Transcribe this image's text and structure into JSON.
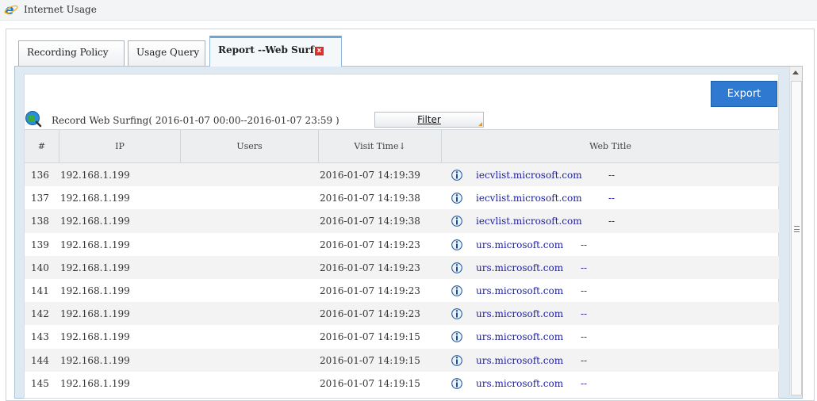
{
  "window": {
    "title": "Internet Usage"
  },
  "tabs": [
    {
      "label": "Recording Policy"
    },
    {
      "label": "Usage Query"
    },
    {
      "label": "Report --Web Surf",
      "close": "x"
    }
  ],
  "toolbar": {
    "export_label": "Export",
    "filter_label": "Filter"
  },
  "record": {
    "title": "Record Web Surfing( 2016-01-07 00:00--2016-01-07 23:59 )"
  },
  "table": {
    "headers": [
      "#",
      "IP",
      "Users",
      "Visit Time↓",
      "Web Title"
    ],
    "rows": [
      {
        "num": "136",
        "ip": "192.168.1.199",
        "user": "",
        "time": "2016-01-07 14:19:39",
        "title": "iecvlist.microsoft.com",
        "suffix": "--"
      },
      {
        "num": "137",
        "ip": "192.168.1.199",
        "user": "",
        "time": "2016-01-07 14:19:38",
        "title": "iecvlist.microsoft.com",
        "suffix": "--"
      },
      {
        "num": "138",
        "ip": "192.168.1.199",
        "user": "",
        "time": "2016-01-07 14:19:38",
        "title": "iecvlist.microsoft.com",
        "suffix": "--"
      },
      {
        "num": "139",
        "ip": "192.168.1.199",
        "user": "",
        "time": "2016-01-07 14:19:23",
        "title": "urs.microsoft.com",
        "suffix": "--"
      },
      {
        "num": "140",
        "ip": "192.168.1.199",
        "user": "",
        "time": "2016-01-07 14:19:23",
        "title": "urs.microsoft.com",
        "suffix": "--"
      },
      {
        "num": "141",
        "ip": "192.168.1.199",
        "user": "",
        "time": "2016-01-07 14:19:23",
        "title": "urs.microsoft.com",
        "suffix": "--"
      },
      {
        "num": "142",
        "ip": "192.168.1.199",
        "user": "",
        "time": "2016-01-07 14:19:23",
        "title": "urs.microsoft.com",
        "suffix": "--"
      },
      {
        "num": "143",
        "ip": "192.168.1.199",
        "user": "",
        "time": "2016-01-07 14:19:15",
        "title": "urs.microsoft.com",
        "suffix": "--"
      },
      {
        "num": "144",
        "ip": "192.168.1.199",
        "user": "",
        "time": "2016-01-07 14:19:15",
        "title": "urs.microsoft.com",
        "suffix": "--"
      },
      {
        "num": "145",
        "ip": "192.168.1.199",
        "user": "",
        "time": "2016-01-07 14:19:15",
        "title": "urs.microsoft.com",
        "suffix": "--"
      }
    ]
  },
  "icons": {
    "app": "internet-explorer-icon",
    "record": "globe-search-icon",
    "row": "info-icon",
    "tab_close": "close-icon"
  },
  "colors": {
    "accent": "#2f7ad0",
    "link": "#1d1f9e",
    "tab_close": "#d9302b",
    "active_tab_border": "#6ea6d2"
  }
}
